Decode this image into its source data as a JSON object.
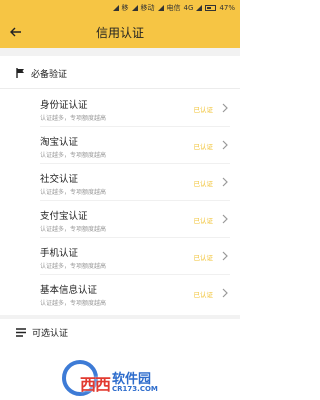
{
  "status_bar": {
    "carrier1": "移",
    "carrier2": "移动",
    "carrier3": "电信",
    "network": "4G",
    "battery": "47%"
  },
  "nav": {
    "title": "信用认证"
  },
  "required_section": {
    "title": "必备验证"
  },
  "items": [
    {
      "name": "身份证认证",
      "sub": "认证越多，专项额度越高",
      "status": "已认证"
    },
    {
      "name": "淘宝认证",
      "sub": "认证越多，专项额度越高",
      "status": "已认证"
    },
    {
      "name": "社交认证",
      "sub": "认证越多，专项额度越高",
      "status": "已认证"
    },
    {
      "name": "支付宝认证",
      "sub": "认证越多，专项额度越高",
      "status": "已认证"
    },
    {
      "name": "手机认证",
      "sub": "认证越多，专项额度越高",
      "status": "已认证"
    },
    {
      "name": "基本信息认证",
      "sub": "认证越多，专项额度越高",
      "status": "已认证"
    }
  ],
  "optional_section": {
    "title": "可选认证"
  },
  "watermark": {
    "main": "西西",
    "side": "软件园",
    "url": "CR173.COM"
  },
  "colors": {
    "accent": "#f6c544",
    "status": "#f1c232"
  }
}
